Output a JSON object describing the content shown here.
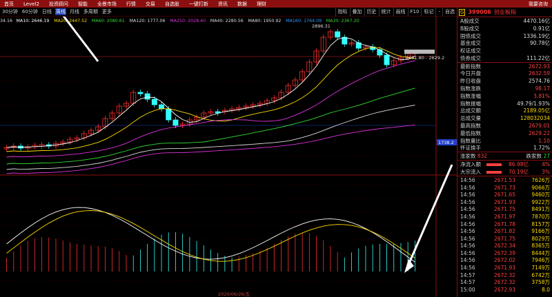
{
  "menu": {
    "items": [
      "首页",
      "Level2",
      "投资顾问",
      "智能",
      "全景市场",
      "行情",
      "交易",
      "自选股",
      "一键打新",
      "资讯",
      "数据",
      "理财"
    ],
    "right_label": "我要咨询"
  },
  "toolbar": {
    "periods": [
      "30分钟",
      "60分钟",
      "日线",
      "周线",
      "月线",
      "多周期",
      "更多"
    ],
    "active_period": "周线",
    "buttons": [
      "指标",
      "叠加",
      "历史",
      "统计",
      "画线",
      "F10",
      "标记",
      "-",
      "自选"
    ]
  },
  "ma_legend": {
    "items": [
      {
        "text": "34.16",
        "color": "#dddddd"
      },
      {
        "text": "MA10: 2646.19",
        "color": "#ffffff"
      },
      {
        "text": "MA20: 2447.52",
        "color": "#ffdd00"
      },
      {
        "text": "MA60: 2080.61",
        "color": "#33dd33"
      },
      {
        "text": "MA120: 1777.06",
        "color": "#dddddd"
      },
      {
        "text": "MA250: 2028.40",
        "color": "#dd33dd"
      },
      {
        "text": "MA40: 2280.56",
        "color": "#dddddd"
      },
      {
        "text": "MA80: 1950.92",
        "color": "#dddddd"
      },
      {
        "text": "MA160: 1764.09",
        "color": "#3399ff"
      },
      {
        "text": "MA30: 2367.20",
        "color": "#33dd33"
      }
    ]
  },
  "chart_annotations": {
    "high_label": "2896.31",
    "range_label": "2601.80 - 2629.2",
    "price_tag": "1738.2",
    "date_label": "2020/06/26/五"
  },
  "colors": {
    "up": "#ff3030",
    "down": "#33ffff",
    "ma5": "#ffffff",
    "ma10": "#ffdd00",
    "ma20": "#dd33dd",
    "ma60": "#33dd33",
    "ma120": "#dddddd",
    "ma250": "#dd33dd",
    "grid": "#5a0000"
  },
  "header": {
    "badge": "G",
    "code": "399006",
    "name": "创业板指"
  },
  "stats_top": [
    {
      "label": "A股成交",
      "value": "4470.16亿",
      "cls": "white"
    },
    {
      "label": "B股成交",
      "value": "0.91亿",
      "cls": "white"
    },
    {
      "label": "国债成交",
      "value": "1336.19亿",
      "cls": "white"
    },
    {
      "label": "基金成交",
      "value": "90.78亿",
      "cls": "white"
    },
    {
      "label": "权证成交",
      "value": "",
      "cls": "white"
    },
    {
      "label": "债券成交",
      "value": "111.22亿",
      "cls": "white"
    }
  ],
  "stats_mid": [
    {
      "label": "最新指数",
      "value": "2672.93",
      "cls": "red"
    },
    {
      "label": "今日开盘",
      "value": "2632.59",
      "cls": "red"
    },
    {
      "label": "昨日收盘",
      "value": "2574.76",
      "cls": "white"
    },
    {
      "label": "指数涨跌",
      "value": "98.17",
      "cls": "red"
    },
    {
      "label": "指数涨幅",
      "value": "3.81%",
      "cls": "red"
    },
    {
      "label": "指数振幅",
      "value": "49.79/1.93%",
      "cls": "white"
    },
    {
      "label": "总成交额",
      "value": "2189.05亿",
      "cls": "yellow"
    },
    {
      "label": "总成交量",
      "value": "128032034",
      "cls": "yellow"
    },
    {
      "label": "最高指数",
      "value": "2679.01",
      "cls": "red"
    },
    {
      "label": "最低指数",
      "value": "2629.22",
      "cls": "red"
    },
    {
      "label": "指数量比",
      "value": "1.10",
      "cls": "red"
    },
    {
      "label": "怀证换手",
      "value": "1.72%",
      "cls": "white"
    }
  ],
  "updown": {
    "up_label": "涨家数",
    "up_value": "832",
    "down_label": "跌家数",
    "down_value": "27"
  },
  "flows": [
    {
      "label": "净流入额",
      "amount": "86.98亿",
      "pct": "4%"
    },
    {
      "label": "大宗流入",
      "amount": "70.19亿",
      "pct": "3%"
    }
  ],
  "ticks": [
    {
      "time": "14:56",
      "price": "2671.53",
      "vol": "7626万"
    },
    {
      "time": "14:56",
      "price": "2671.73",
      "vol": "9066万"
    },
    {
      "time": "14:56",
      "price": "2671.65",
      "vol": "9460万"
    },
    {
      "time": "14:56",
      "price": "2671.93",
      "vol": "9922万"
    },
    {
      "time": "14:56",
      "price": "2671.75",
      "vol": "8491万"
    },
    {
      "time": "14:56",
      "price": "2671.97",
      "vol": "7870万"
    },
    {
      "time": "14:56",
      "price": "2671.78",
      "vol": "8157万"
    },
    {
      "time": "14:56",
      "price": "2671.82",
      "vol": "9166万"
    },
    {
      "time": "14:56",
      "price": "2671.75",
      "vol": "8029万"
    },
    {
      "time": "14:56",
      "price": "2672.34",
      "vol": "8365万"
    },
    {
      "time": "14:56",
      "price": "2672.39",
      "vol": "8444万"
    },
    {
      "time": "14:56",
      "price": "2672.02",
      "vol": "7946万"
    },
    {
      "time": "14:56",
      "price": "2671.93",
      "vol": "7149万"
    },
    {
      "time": "14:57",
      "price": "2672.32",
      "vol": "6742万"
    },
    {
      "time": "14:57",
      "price": "2672.32",
      "vol": "3758万"
    },
    {
      "time": "15:00",
      "price": "2672.93",
      "vol": "8.0"
    }
  ]
}
